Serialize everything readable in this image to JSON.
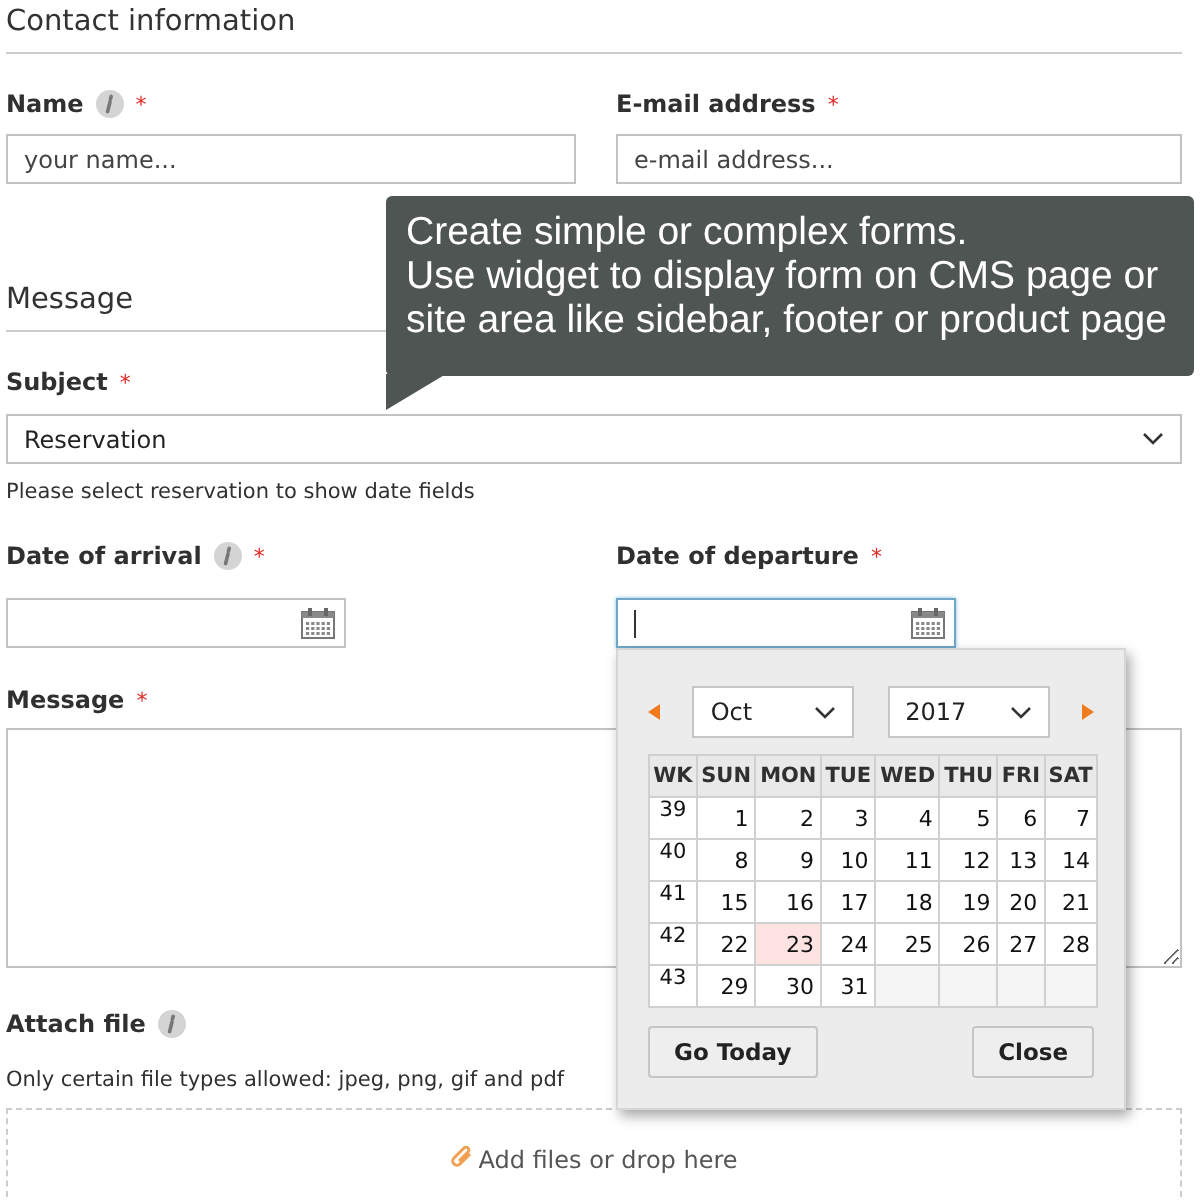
{
  "sections": [
    {
      "title": "Contact information"
    },
    {
      "title": "Message"
    }
  ],
  "name_field": {
    "label": "Name",
    "info": true,
    "required_mark": "*",
    "placeholder": "your name..."
  },
  "email_field": {
    "label": "E-mail address",
    "info": false,
    "required_mark": "*",
    "placeholder": "e-mail address..."
  },
  "tooltip": {
    "lines": [
      "Create simple or complex forms.",
      "Use widget to display form on CMS page or",
      "site area like sidebar, footer or product page"
    ]
  },
  "subject": {
    "label": "Subject",
    "required_mark": "*",
    "value": "Reservation",
    "help": "Please select reservation to show date fields"
  },
  "arrival": {
    "label": "Date of arrival",
    "info": true,
    "required_mark": "*",
    "focused": false
  },
  "departure": {
    "label": "Date of departure",
    "info": false,
    "required_mark": "*",
    "focused": true
  },
  "message": {
    "label": "Message",
    "required_mark": "*"
  },
  "attach": {
    "label": "Attach file",
    "info": true,
    "note": "Only certain file types allowed: jpeg, png, gif and pdf",
    "drop_text": "Add files or drop here"
  },
  "datepicker": {
    "month": "Oct",
    "year": "2017",
    "headers": [
      "WK",
      "SUN",
      "MON",
      "TUE",
      "WED",
      "THU",
      "FRI",
      "SAT"
    ],
    "weeks": [
      {
        "wk": "39",
        "days": [
          {
            "day": "1",
            "today": false
          },
          {
            "day": "2",
            "today": false
          },
          {
            "day": "3",
            "today": false
          },
          {
            "day": "4",
            "today": false
          },
          {
            "day": "5",
            "today": false
          },
          {
            "day": "6",
            "today": false
          },
          {
            "day": "7",
            "today": false
          }
        ]
      },
      {
        "wk": "40",
        "days": [
          {
            "day": "8",
            "today": false
          },
          {
            "day": "9",
            "today": false
          },
          {
            "day": "10",
            "today": false
          },
          {
            "day": "11",
            "today": false
          },
          {
            "day": "12",
            "today": false
          },
          {
            "day": "13",
            "today": false
          },
          {
            "day": "14",
            "today": false
          }
        ]
      },
      {
        "wk": "41",
        "days": [
          {
            "day": "15",
            "today": false
          },
          {
            "day": "16",
            "today": false
          },
          {
            "day": "17",
            "today": false
          },
          {
            "day": "18",
            "today": false
          },
          {
            "day": "19",
            "today": false
          },
          {
            "day": "20",
            "today": false
          },
          {
            "day": "21",
            "today": false
          }
        ]
      },
      {
        "wk": "42",
        "days": [
          {
            "day": "22",
            "today": false
          },
          {
            "day": "23",
            "today": true
          },
          {
            "day": "24",
            "today": false
          },
          {
            "day": "25",
            "today": false
          },
          {
            "day": "26",
            "today": false
          },
          {
            "day": "27",
            "today": false
          },
          {
            "day": "28",
            "today": false
          }
        ]
      },
      {
        "wk": "43",
        "days": [
          {
            "day": "29",
            "today": false
          },
          {
            "day": "30",
            "today": false
          },
          {
            "day": "31",
            "today": false
          }
        ]
      }
    ],
    "buttons": [
      "Go Today",
      "Close"
    ]
  }
}
